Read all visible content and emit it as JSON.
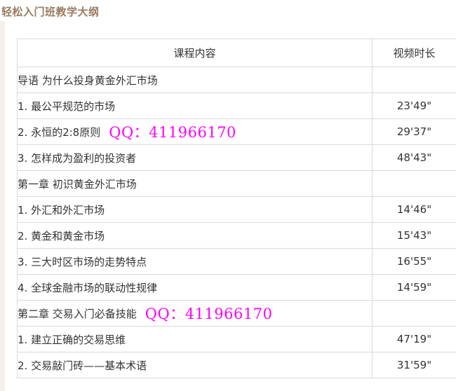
{
  "title": "轻松入门班教学大纲",
  "table": {
    "header": {
      "content": "课程内容",
      "duration": "视频时长"
    },
    "rows": [
      {
        "kind": "chapter",
        "text": "导语 为什么投身黄金外汇市场",
        "duration": ""
      },
      {
        "kind": "lesson",
        "text": "1. 最公平规范的市场",
        "duration": "23'49\""
      },
      {
        "kind": "lesson",
        "text": "2. 永恒的2:8原则",
        "duration": "29'37\"",
        "watermark": "QQ：411966170"
      },
      {
        "kind": "lesson",
        "text": "3. 怎样成为盈利的投资者",
        "duration": "48'43\""
      },
      {
        "kind": "chapter",
        "text": "第一章 初识黄金外汇市场",
        "duration": ""
      },
      {
        "kind": "lesson",
        "text": "1. 外汇和外汇市场",
        "duration": "14'46\""
      },
      {
        "kind": "lesson",
        "text": "2. 黄金和黄金市场",
        "duration": "15'43\""
      },
      {
        "kind": "lesson",
        "text": "3. 三大时区市场的走势特点",
        "duration": "16'55\""
      },
      {
        "kind": "lesson",
        "text": "4. 全球金融市场的联动性规律",
        "duration": "14'59\""
      },
      {
        "kind": "chapter",
        "text": "第二章 交易入门必备技能",
        "duration": "",
        "watermark": "QQ：411966170"
      },
      {
        "kind": "lesson",
        "text": "1. 建立正确的交易思维",
        "duration": "47'19\""
      },
      {
        "kind": "lesson",
        "text": "2. 交易敲门砖——基本术语",
        "duration": "31'59\""
      }
    ]
  }
}
